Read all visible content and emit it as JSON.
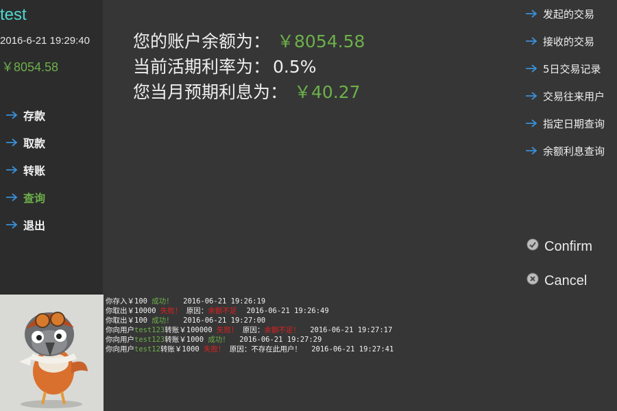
{
  "user": {
    "name": "test",
    "datetime": "2016-6-21 19:29:40",
    "balance": "￥8054.58"
  },
  "nav": [
    {
      "label": "存款",
      "icon": "arrow-right-icon"
    },
    {
      "label": "取款",
      "icon": "arrow-right-icon"
    },
    {
      "label": "转账",
      "icon": "arrow-right-icon"
    },
    {
      "label": "查询",
      "icon": "arrow-right-icon",
      "active": true
    },
    {
      "label": "退出",
      "icon": "arrow-right-icon"
    }
  ],
  "summary": {
    "balance_label": "您的账户余额为：",
    "balance_value": "￥8054.58",
    "rate_label": "当前活期利率为：",
    "rate_value": "0.5%",
    "interest_label": "您当月预期利息为：",
    "interest_value": "￥40.27"
  },
  "query_menu": [
    {
      "label": "发起的交易",
      "icon": "arrow-right-icon"
    },
    {
      "label": "接收的交易",
      "icon": "arrow-right-icon"
    },
    {
      "label": "5日交易记录",
      "icon": "arrow-right-icon"
    },
    {
      "label": "交易往来用户",
      "icon": "arrow-right-icon"
    },
    {
      "label": "指定日期查询",
      "icon": "arrow-right-icon"
    },
    {
      "label": "余额利息查询",
      "icon": "arrow-right-icon"
    }
  ],
  "actions": {
    "confirm_label": "Confirm",
    "cancel_label": "Cancel"
  },
  "log": [
    {
      "action": "你存入￥100",
      "status": "成功！",
      "status_type": "ok",
      "time": "2016-06-21 19:26:19"
    },
    {
      "action": "你取出￥10000",
      "status": "失败！",
      "status_type": "fail",
      "reason_label": "原因：",
      "reason": "余额不足",
      "time": "2016-06-21 19:26:49"
    },
    {
      "action": "你取出￥100",
      "status": "成功！",
      "status_type": "ok",
      "time": "2016-06-21 19:27:00"
    },
    {
      "prefix": "你向用户",
      "peer": "test123",
      "action": "转账￥100000",
      "status": "失败！",
      "status_type": "fail",
      "reason_label": "原因：",
      "reason": "余额不足！",
      "time": "2016-06-21 19:27:17"
    },
    {
      "prefix": "你向用户",
      "peer": "test123",
      "action": "转账￥1000",
      "status": "成功！",
      "status_type": "ok",
      "time": "2016-06-21 19:27:29"
    },
    {
      "prefix": "你向用户",
      "peer": "test12",
      "action": "转账￥1000",
      "status": "失败！",
      "status_type": "fail",
      "reason_label": "原因：",
      "reason": "不存在此用户！",
      "reason_type": "plain",
      "time": "2016-06-21 19:27:41"
    }
  ],
  "colors": {
    "accent_green": "#6db04a",
    "accent_cyan": "#4fd8d0",
    "error_red": "#e02020",
    "arrow_blue": "#3a8fd8"
  }
}
